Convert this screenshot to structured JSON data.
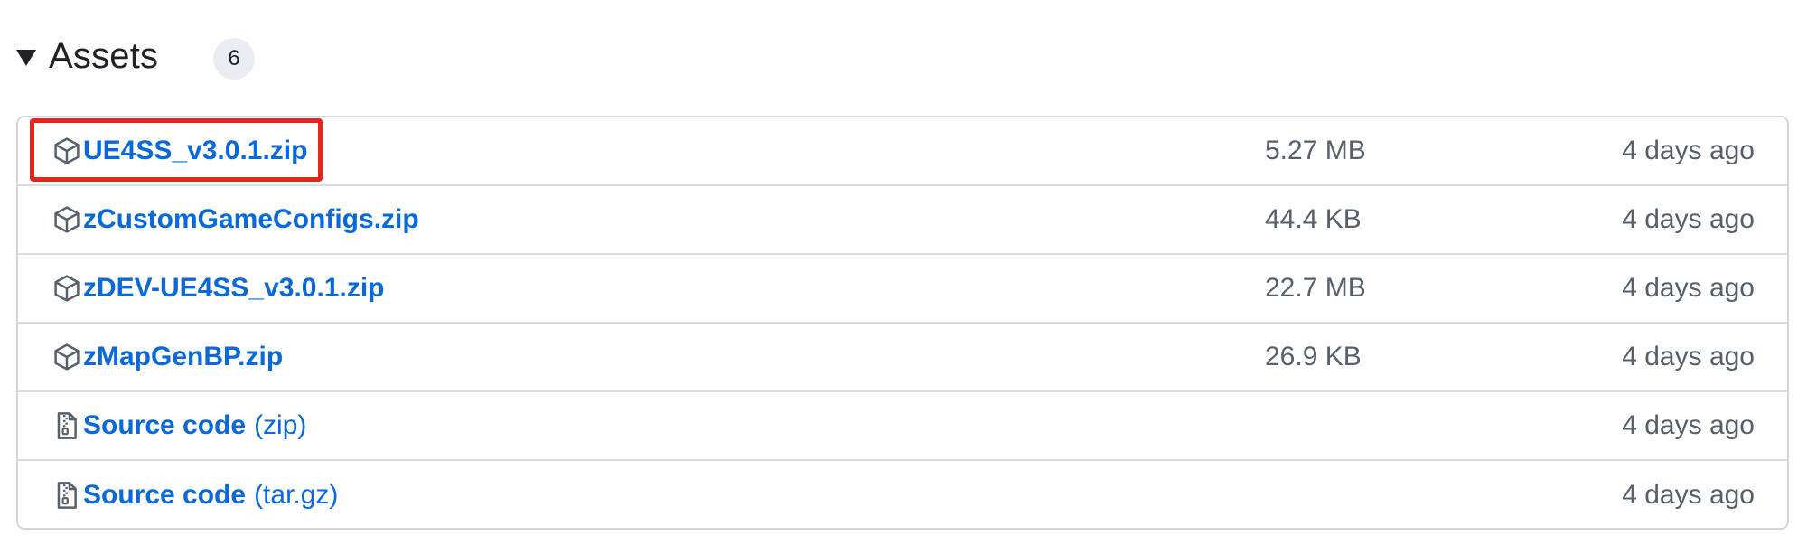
{
  "assets": {
    "title": "Assets",
    "count": "6",
    "items": [
      {
        "icon": "package-icon",
        "name": "UE4SS_v3.0.1.zip",
        "sub": "",
        "size": "5.27 MB",
        "date": "4 days ago",
        "highlighted": true
      },
      {
        "icon": "package-icon",
        "name": "zCustomGameConfigs.zip",
        "sub": "",
        "size": "44.4 KB",
        "date": "4 days ago"
      },
      {
        "icon": "package-icon",
        "name": "zDEV-UE4SS_v3.0.1.zip",
        "sub": "",
        "size": "22.7 MB",
        "date": "4 days ago"
      },
      {
        "icon": "package-icon",
        "name": "zMapGenBP.zip",
        "sub": "",
        "size": "26.9 KB",
        "date": "4 days ago"
      },
      {
        "icon": "file-zip-icon",
        "name": "Source code",
        "sub": "(zip)",
        "size": "",
        "date": "4 days ago"
      },
      {
        "icon": "file-zip-icon",
        "name": "Source code",
        "sub": "(tar.gz)",
        "size": "",
        "date": "4 days ago"
      }
    ]
  },
  "colors": {
    "link": "#0969da",
    "muted": "#57606a",
    "border": "#d0d7de",
    "highlight": "#e8231c",
    "badge_bg": "#eaeef2"
  }
}
